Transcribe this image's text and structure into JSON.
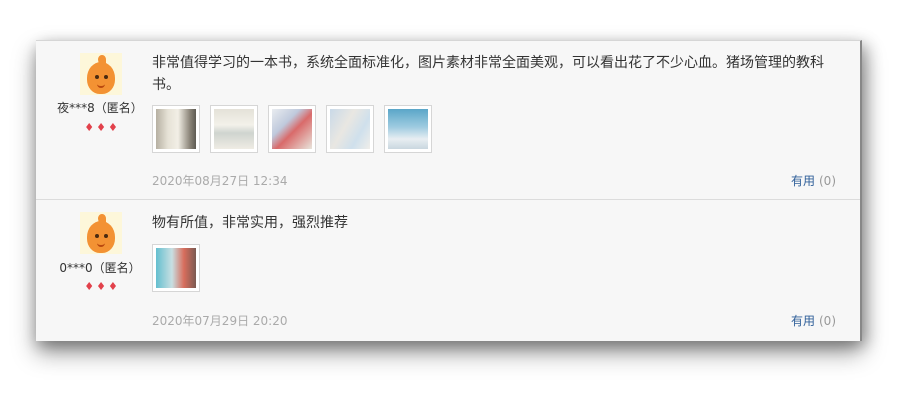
{
  "reviews": [
    {
      "user": "夜***8（匿名）",
      "text": "非常值得学习的一本书，系统全面标准化，图片素材非常全面美观，可以看出花了不少心血。猪场管理的教科书。",
      "date": "2020年08月27日 12:34",
      "useful_label": "有用",
      "useful_count": "(0)",
      "thumbnails": 5,
      "rank_icon": "diamond-icon"
    },
    {
      "user": "0***0（匿名）",
      "text": "物有所值，非常实用，强烈推荐",
      "date": "2020年07月29日 20:20",
      "useful_label": "有用",
      "useful_count": "(0)",
      "thumbnails": 1,
      "rank_icon": "diamond-icon"
    }
  ],
  "colors": {
    "background": "#f7f7f7",
    "link": "#2f5f99",
    "rank": "#e2414b",
    "meta": "#aaaaaa"
  }
}
